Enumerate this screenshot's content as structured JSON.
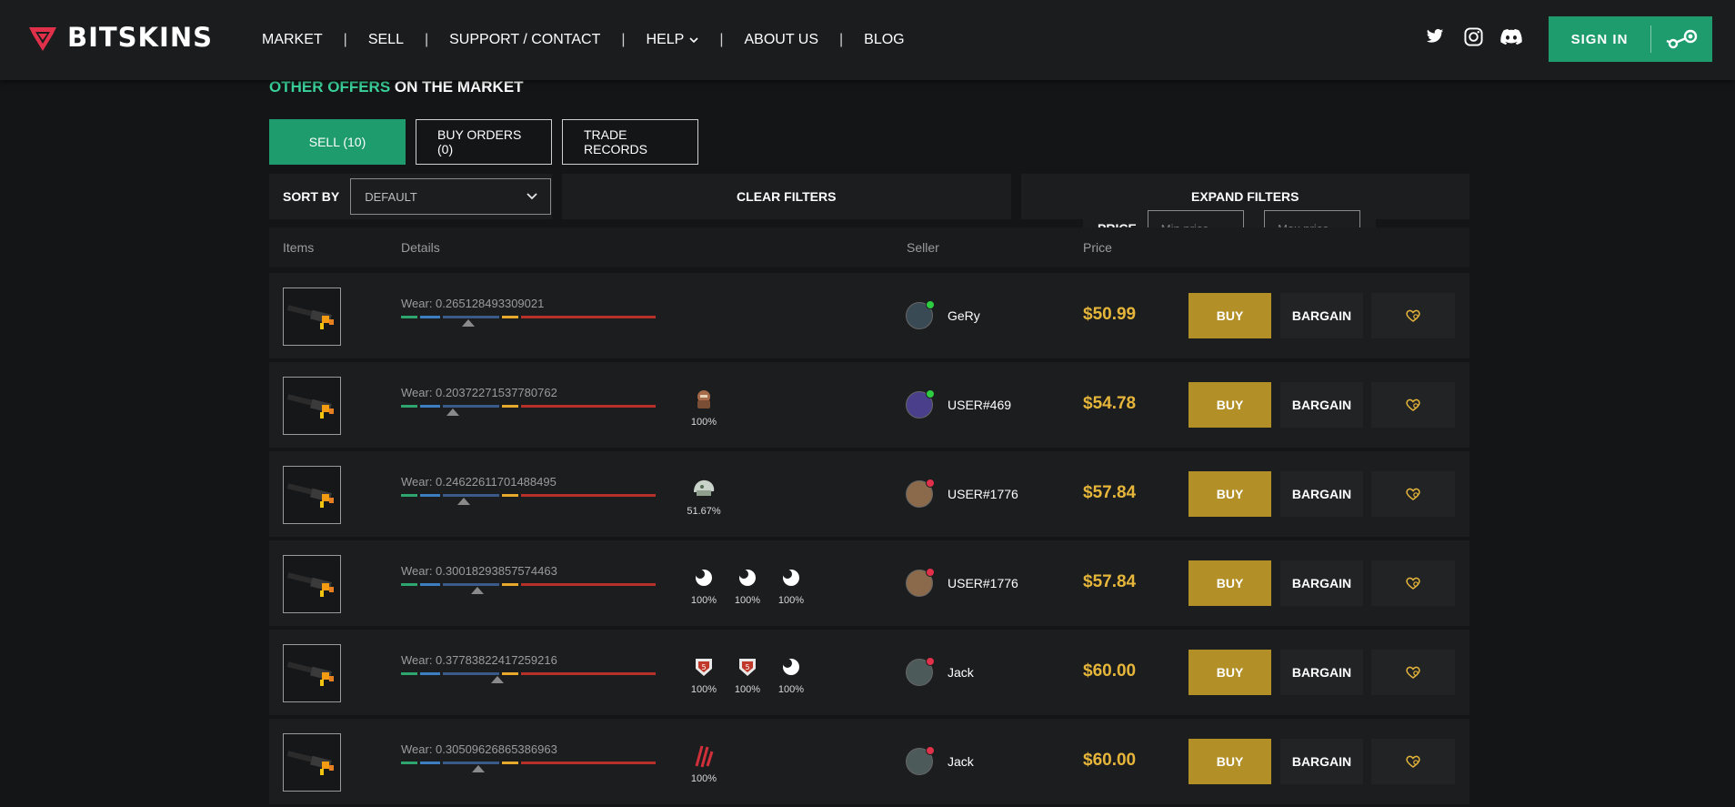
{
  "brand": {
    "name": "BITSKINS"
  },
  "nav": [
    "MARKET",
    "SELL",
    "SUPPORT / CONTACT",
    "HELP",
    "ABOUT US",
    "BLOG"
  ],
  "header": {
    "signin_label": "SIGN IN"
  },
  "section": {
    "title_accent": "OTHER OFFERS",
    "title_rest": " ON THE MARKET"
  },
  "tabs": [
    "SELL (10)",
    "BUY ORDERS (0)",
    "TRADE RECORDS"
  ],
  "filters": {
    "sort_label": "SORT BY",
    "sort_value": "DEFAULT",
    "price_label": "PRICE",
    "min_placeholder": "Min price",
    "max_placeholder": "Max price",
    "dash": "-",
    "clear_label": "CLEAR FILTERS",
    "expand_label": "EXPAND FILTERS"
  },
  "columns": {
    "items": "Items",
    "details": "Details",
    "seller": "Seller",
    "price": "Price"
  },
  "actions": {
    "buy": "BUY",
    "bargain": "BARGAIN"
  },
  "colors": {
    "accent": "#1e9c6e",
    "accent_text": "#3bd29b",
    "price": "#e6b63b",
    "buy": "#b38f27",
    "online": "#2ecc40",
    "offline": "#e0304a"
  },
  "rows": [
    {
      "wear_label": "Wear: 0.265128493309021",
      "wear": 0.265128493309021,
      "stickers": [],
      "seller": "GeRy",
      "status": "online",
      "price": "$50.99"
    },
    {
      "wear_label": "Wear: 0.20372271537780762",
      "wear": 0.20372271537780762,
      "stickers": [
        {
          "icon": "character-sticker-icon",
          "pct": "100%"
        }
      ],
      "seller": "USER#469",
      "status": "online",
      "price": "$54.78"
    },
    {
      "wear_label": "Wear: 0.24622611701488495",
      "wear": 0.24622611701488495,
      "stickers": [
        {
          "icon": "helmet-sticker-icon",
          "pct": "51.67%"
        }
      ],
      "seller": "USER#1776",
      "status": "offline",
      "price": "$57.84"
    },
    {
      "wear_label": "Wear: 0.30018293857574463",
      "wear": 0.30018293857574463,
      "stickers": [
        {
          "icon": "moon-sticker-icon",
          "pct": "100%"
        },
        {
          "icon": "moon-sticker-icon",
          "pct": "100%"
        },
        {
          "icon": "moon-sticker-icon",
          "pct": "100%"
        }
      ],
      "seller": "USER#1776",
      "status": "offline",
      "price": "$57.84"
    },
    {
      "wear_label": "Wear: 0.37783822417259216",
      "wear": 0.37783822417259216,
      "stickers": [
        {
          "icon": "badge-sticker-icon",
          "pct": "100%"
        },
        {
          "icon": "badge-sticker-icon",
          "pct": "100%"
        },
        {
          "icon": "moon-sticker-icon",
          "pct": "100%"
        }
      ],
      "seller": "Jack",
      "status": "offline",
      "price": "$60.00"
    },
    {
      "wear_label": "Wear: 0.30509626865386963",
      "wear": 0.30509626865386963,
      "stickers": [
        {
          "icon": "claw-sticker-icon",
          "pct": "100%"
        }
      ],
      "seller": "Jack",
      "status": "offline",
      "price": "$60.00"
    }
  ]
}
